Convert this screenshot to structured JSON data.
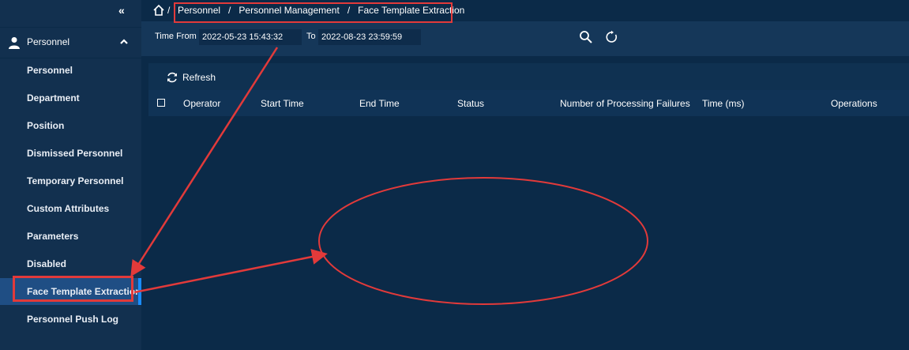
{
  "sidebar": {
    "collapse_glyph": "«",
    "group": {
      "label": "Personnel",
      "icon": "person-icon",
      "expanded": true
    },
    "items": [
      {
        "label": "Personnel"
      },
      {
        "label": "Department"
      },
      {
        "label": "Position"
      },
      {
        "label": "Dismissed Personnel"
      },
      {
        "label": "Temporary Personnel"
      },
      {
        "label": "Custom Attributes"
      },
      {
        "label": "Parameters"
      },
      {
        "label": "Disabled"
      },
      {
        "label": "Face Template Extraction",
        "active": true
      },
      {
        "label": "Personnel Push Log"
      }
    ]
  },
  "breadcrumb": {
    "separator": "/",
    "items": [
      "Personnel",
      "Personnel Management",
      "Face Template Extraction"
    ]
  },
  "filter": {
    "time_from_label": "Time From",
    "time_from_value": "2022-05-23 15:43:32",
    "to_label": "To",
    "to_value": "2022-08-23 23:59:59"
  },
  "toolbar": {
    "refresh_label": "Refresh"
  },
  "table": {
    "columns": [
      "Operator",
      "Start Time",
      "End Time",
      "Status",
      "Number of Processing Failures",
      "Time (ms)",
      "Operations"
    ],
    "rows": []
  },
  "colors": {
    "background": "#0b2a48",
    "sidebar": "#12304f",
    "active_item": "#1f4e84",
    "active_accent": "#1a8cff",
    "annotation": "#e23a3a"
  }
}
